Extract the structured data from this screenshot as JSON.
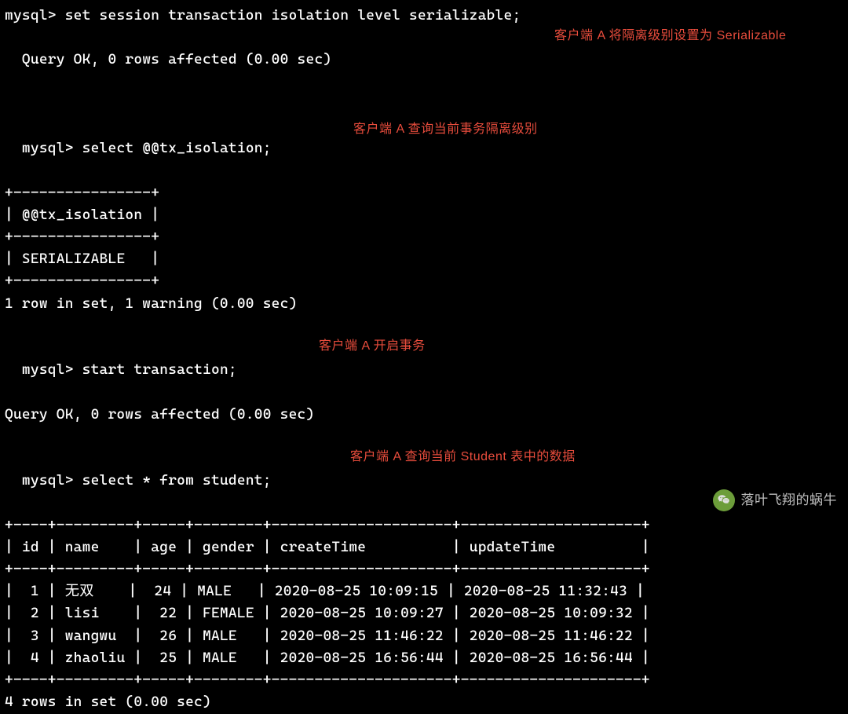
{
  "terminal": {
    "prompt": "mysql>",
    "commands": {
      "set_isolation": "set session transaction isolation level serializable;",
      "set_isolation_result": "Query OK, 0 rows affected (0.00 sec)",
      "select_isolation": "select @@tx_isolation;",
      "isolation_header": "@@tx_isolation",
      "isolation_value": "SERIALIZABLE",
      "isolation_result": "1 row in set, 1 warning (0.00 sec)",
      "start_txn": "start transaction;",
      "start_txn_result": "Query OK, 0 rows affected (0.00 sec)",
      "select_student": "select * from student;",
      "select_student_result": "4 rows in set (0.00 sec)"
    },
    "student_table": {
      "headers": [
        "id",
        "name",
        "age",
        "gender",
        "createTime",
        "updateTime"
      ],
      "rows": [
        {
          "id": "1",
          "name": "无双",
          "age": "24",
          "gender": "MALE",
          "createTime": "2020-08-25 10:09:15",
          "updateTime": "2020-08-25 11:32:43"
        },
        {
          "id": "2",
          "name": "lisi",
          "age": "22",
          "gender": "FEMALE",
          "createTime": "2020-08-25 10:09:27",
          "updateTime": "2020-08-25 10:09:32"
        },
        {
          "id": "3",
          "name": "wangwu",
          "age": "26",
          "gender": "MALE",
          "createTime": "2020-08-25 11:46:22",
          "updateTime": "2020-08-25 11:46:22"
        },
        {
          "id": "4",
          "name": "zhaoliu",
          "age": "25",
          "gender": "MALE",
          "createTime": "2020-08-25 16:56:44",
          "updateTime": "2020-08-25 16:56:44"
        }
      ]
    }
  },
  "annotations": {
    "a1": "客户端 A 将隔离级别设置为 Serializable",
    "a2": "客户端 A 查询当前事务隔离级别",
    "a3": "客户端 A 开启事务",
    "a4": "客户端 A 查询当前 Student 表中的数据"
  },
  "watermark": {
    "text": "落叶飞翔的蜗牛"
  }
}
